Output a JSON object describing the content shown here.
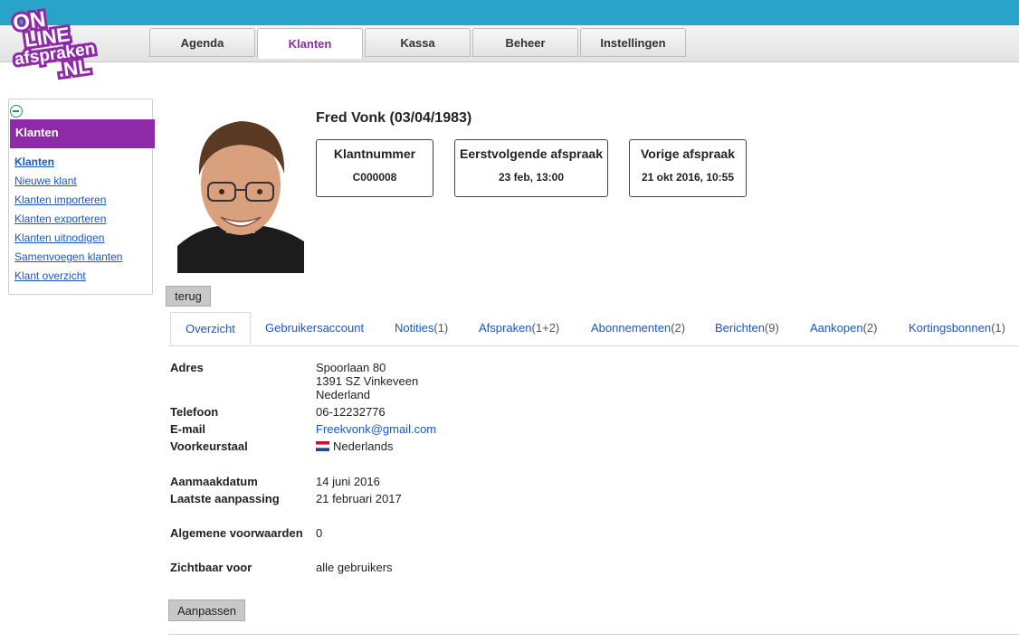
{
  "logo": {
    "line1": "ON",
    "line2": "LINE",
    "line3": "afspraken",
    "line4": ".NL"
  },
  "nav": {
    "tabs": [
      {
        "label": "Agenda"
      },
      {
        "label": "Klanten"
      },
      {
        "label": "Kassa"
      },
      {
        "label": "Beheer"
      },
      {
        "label": "Instellingen"
      }
    ]
  },
  "sidebar": {
    "heading": "Klanten",
    "items": [
      {
        "label": "Klanten"
      },
      {
        "label": "Nieuwe klant"
      },
      {
        "label": "Klanten importeren"
      },
      {
        "label": "Klanten exporteren"
      },
      {
        "label": "Klanten uitnodigen"
      },
      {
        "label": "Samenvoegen klanten"
      },
      {
        "label": "Klant overzicht"
      }
    ]
  },
  "customer": {
    "name": "Fred Vonk (03/04/1983)",
    "boxes": [
      {
        "title": "Klantnummer",
        "value": "C000008"
      },
      {
        "title": "Eerstvolgende afspraak",
        "value": "23 feb, 13:00"
      },
      {
        "title": "Vorige afspraak",
        "value": "21 okt 2016, 10:55"
      }
    ]
  },
  "back_button": "terug",
  "subtabs": [
    {
      "label": "Overzicht",
      "count": ""
    },
    {
      "label": "Gebruikersaccount",
      "count": ""
    },
    {
      "label": "Notities",
      "count": "(1)"
    },
    {
      "label": "Afspraken",
      "count": "(1+2)"
    },
    {
      "label": "Abonnementen",
      "count": "(2)"
    },
    {
      "label": "Berichten",
      "count": "(9)"
    },
    {
      "label": "Aankopen",
      "count": "(2)"
    },
    {
      "label": "Kortingsbonnen",
      "count": "(1)"
    }
  ],
  "details": {
    "address_label": "Adres",
    "address_line1": "Spoorlaan 80",
    "address_line2": "1391 SZ Vinkeveen",
    "address_line3": "Nederland",
    "phone_label": "Telefoon",
    "phone": "06-12232776",
    "email_label": "E-mail",
    "email": "Freekvonk@gmail.com",
    "language_label": "Voorkeurstaal",
    "language": "Nederlands",
    "created_label": "Aanmaakdatum",
    "created": "14 juni 2016",
    "modified_label": "Laatste aanpassing",
    "modified": "21 februari 2017",
    "terms_label": "Algemene voorwaarden",
    "terms": "0",
    "visible_label": "Zichtbaar voor",
    "visible": "alle gebruikers"
  },
  "edit_button": "Aanpassen",
  "colors": {
    "topbar": "#2aa3cb",
    "accent": "#8e2aa7",
    "link": "#1a56c8"
  }
}
